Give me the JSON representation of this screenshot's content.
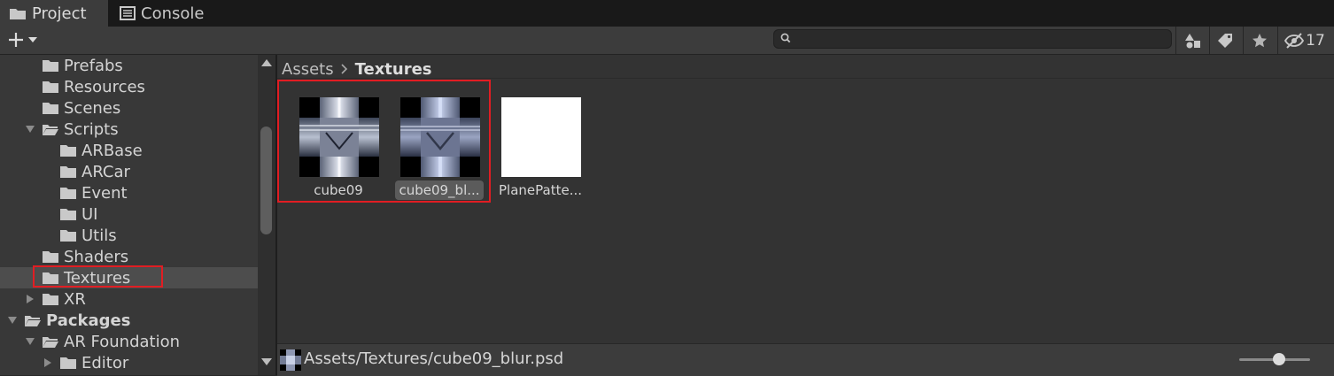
{
  "tabs": [
    {
      "label": "Project",
      "icon": "folder-icon",
      "active": true
    },
    {
      "label": "Console",
      "icon": "console-icon",
      "active": false
    }
  ],
  "toolbar": {
    "create_icon": "plus-icon",
    "search_placeholder": "",
    "hidden_packages_count": "17"
  },
  "tree": [
    {
      "label": "Prefabs",
      "depth": 1,
      "expanded": false,
      "has_children": false
    },
    {
      "label": "Resources",
      "depth": 1,
      "expanded": false,
      "has_children": false
    },
    {
      "label": "Scenes",
      "depth": 1,
      "expanded": false,
      "has_children": false
    },
    {
      "label": "Scripts",
      "depth": 1,
      "expanded": true,
      "has_children": true
    },
    {
      "label": "ARBase",
      "depth": 2,
      "expanded": false,
      "has_children": false
    },
    {
      "label": "ARCar",
      "depth": 2,
      "expanded": false,
      "has_children": false
    },
    {
      "label": "Event",
      "depth": 2,
      "expanded": false,
      "has_children": false
    },
    {
      "label": "UI",
      "depth": 2,
      "expanded": false,
      "has_children": false
    },
    {
      "label": "Utils",
      "depth": 2,
      "expanded": false,
      "has_children": false
    },
    {
      "label": "Shaders",
      "depth": 1,
      "expanded": false,
      "has_children": false
    },
    {
      "label": "Textures",
      "depth": 1,
      "expanded": false,
      "has_children": false,
      "selected": true
    },
    {
      "label": "XR",
      "depth": 1,
      "expanded": false,
      "has_children": true
    },
    {
      "label": "Packages",
      "depth": 0,
      "expanded": true,
      "has_children": true,
      "bold": true
    },
    {
      "label": "AR Foundation",
      "depth": 1,
      "expanded": true,
      "has_children": true
    },
    {
      "label": "Editor",
      "depth": 2,
      "expanded": false,
      "has_children": true
    }
  ],
  "breadcrumb": {
    "root": "Assets",
    "separator": ">",
    "current": "Textures"
  },
  "assets": [
    {
      "label": "cube09",
      "type": "cubemap-texture",
      "selected": false
    },
    {
      "label": "cube09_bl...",
      "type": "cubemap-texture",
      "selected": true
    },
    {
      "label": "PlanePatte...",
      "type": "white-texture",
      "selected": false
    }
  ],
  "status": {
    "path": "Assets/Textures/cube09_blur.psd"
  },
  "colors": {
    "highlight": "#e11d23",
    "selection": "#4d4d4d"
  }
}
